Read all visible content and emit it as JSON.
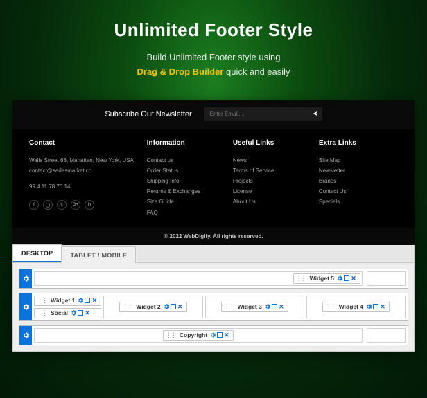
{
  "hero": {
    "title": "Unlimited Footer Style",
    "line1": "Build Unlimited Footer style using",
    "highlight": "Drag & Drop Builder",
    "line1_suffix": " quick and easily"
  },
  "newsletter": {
    "label": "Subscribe Our Newsletter",
    "placeholder": "Enter Email...."
  },
  "footer": {
    "contact": {
      "heading": "Contact",
      "address": "Walls Street 68, Mahattan, New York, USA",
      "email": "contact@sadesmarket.co",
      "phone": "99 4 11 78 70 14"
    },
    "information": {
      "heading": "Information",
      "items": [
        "Contact us",
        "Order Status",
        "Shipping Info",
        "Returns & Exchanges",
        "Size Guide",
        "FAQ"
      ]
    },
    "useful": {
      "heading": "Useful Links",
      "items": [
        "News",
        "Terms of Service",
        "Projects",
        "License",
        "About Us"
      ]
    },
    "extra": {
      "heading": "Extra Links",
      "items": [
        "Site Map",
        "Newsletter",
        "Brands",
        "Contact Us",
        "Specials"
      ]
    },
    "copyright": "© 2022 WebDigify. All rights reserved."
  },
  "builder": {
    "tabs": {
      "desktop": "DESKTOP",
      "mobile": "TABLET / MOBILE"
    },
    "widgets": {
      "w1": "Widget 1",
      "w2": "Widget 2",
      "w3": "Widget 3",
      "w4": "Widget 4",
      "w5": "Widget 5",
      "social": "Social",
      "copyright": "Copyright"
    }
  }
}
